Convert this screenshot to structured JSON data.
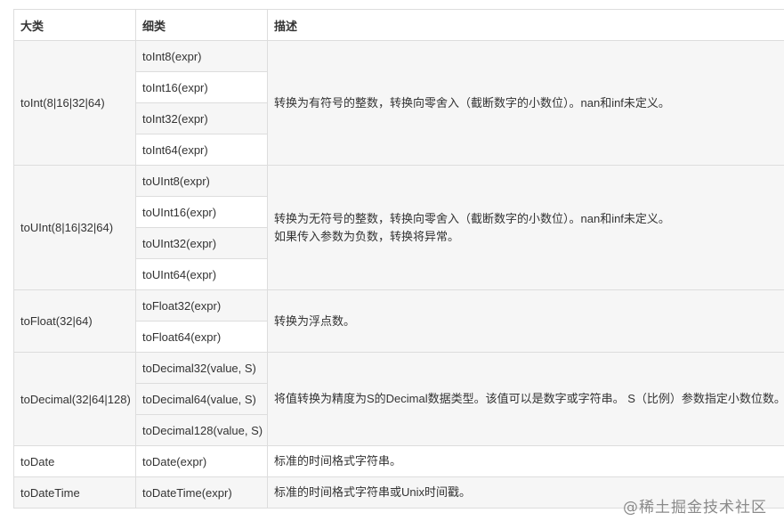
{
  "headers": [
    "大类",
    "细类",
    "描述"
  ],
  "groups": [
    {
      "category": "toInt(8|16|32|64)",
      "functions": [
        "toInt8(expr)",
        "toInt16(expr)",
        "toInt32(expr)",
        "toInt64(expr)"
      ],
      "description": [
        "转换为有符号的整数，转换向零舍入（截断数字的小数位）。nan和inf未定义。"
      ]
    },
    {
      "category": "toUInt(8|16|32|64)",
      "functions": [
        "toUInt8(expr)",
        "toUInt16(expr)",
        "toUInt32(expr)",
        "toUInt64(expr)"
      ],
      "description": [
        "转换为无符号的整数，转换向零舍入（截断数字的小数位）。nan和inf未定义。",
        "如果传入参数为负数，转换将异常。"
      ]
    },
    {
      "category": "toFloat(32|64)",
      "functions": [
        "toFloat32(expr)",
        "toFloat64(expr)"
      ],
      "description": [
        "转换为浮点数。"
      ]
    },
    {
      "category": "toDecimal(32|64|128)",
      "functions": [
        "toDecimal32(value, S)",
        "toDecimal64(value, S)",
        "toDecimal128(value, S)"
      ],
      "description": [
        "将值转换为精度为S的Decimal数据类型。该值可以是数字或字符串。 S（比例）参数指定小数位数。"
      ]
    },
    {
      "category": "toDate",
      "functions": [
        "toDate(expr)"
      ],
      "description": [
        "标准的时间格式字符串。"
      ]
    },
    {
      "category": "toDateTime",
      "functions": [
        "toDateTime(expr)"
      ],
      "description": [
        "标准的时间格式字符串或Unix时间戳。"
      ]
    }
  ],
  "watermark": "@稀土掘金技术社区"
}
